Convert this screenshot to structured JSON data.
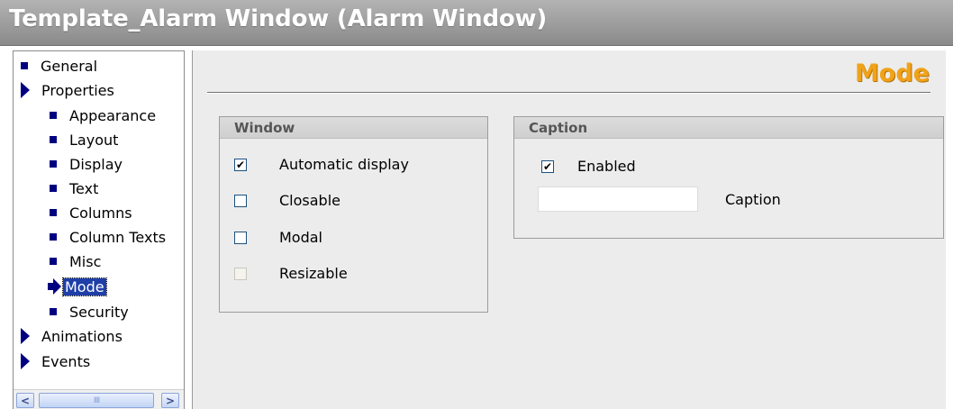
{
  "window": {
    "title": "Template_Alarm Window (Alarm Window)"
  },
  "nav": {
    "items": [
      {
        "label": "General"
      },
      {
        "label": "Properties"
      },
      {
        "label": "Appearance"
      },
      {
        "label": "Layout"
      },
      {
        "label": "Display"
      },
      {
        "label": "Text"
      },
      {
        "label": "Columns"
      },
      {
        "label": "Column Texts"
      },
      {
        "label": "Misc"
      },
      {
        "label": "Mode",
        "selected": true
      },
      {
        "label": "Security"
      },
      {
        "label": "Animations"
      },
      {
        "label": "Events"
      }
    ],
    "scrollbar": {
      "left": "<",
      "right": ">",
      "grip": "IIII"
    }
  },
  "page": {
    "heading": "Mode"
  },
  "window_group": {
    "title": "Window",
    "options": [
      {
        "label": "Automatic display",
        "checked": true,
        "enabled": true
      },
      {
        "label": "Closable",
        "checked": false,
        "enabled": true
      },
      {
        "label": "Modal",
        "checked": false,
        "enabled": true
      },
      {
        "label": "Resizable",
        "checked": false,
        "enabled": false
      }
    ]
  },
  "caption_group": {
    "title": "Caption",
    "enabled_label": "Enabled",
    "enabled_checked": true,
    "caption_label": "Caption",
    "caption_value": ""
  },
  "colors": {
    "accent": "#f0a21a",
    "nav_marker": "#000080",
    "selection": "#1f3fa8"
  }
}
